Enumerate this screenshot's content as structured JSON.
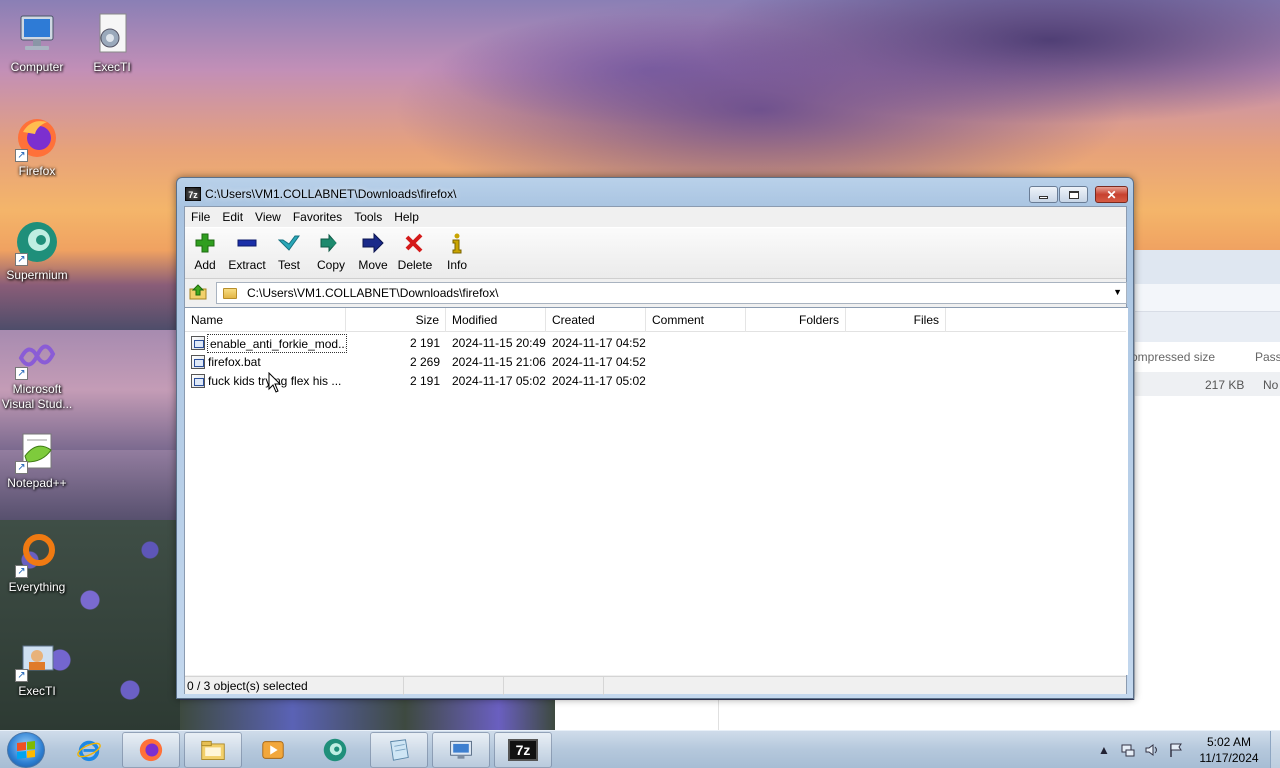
{
  "desktop": {
    "icons": [
      {
        "label": "Computer"
      },
      {
        "label": "ExecTI"
      },
      {
        "label": "Firefox"
      },
      {
        "label": "Supermium"
      },
      {
        "label": "Microsoft Visual Stud..."
      },
      {
        "label": "Notepad++"
      },
      {
        "label": "Everything"
      },
      {
        "label": "ExecTI"
      }
    ]
  },
  "background_window": {
    "column_compressed": "ompressed size",
    "column_password": "Passw",
    "row_size": "217 KB",
    "row_password": "No"
  },
  "window": {
    "title": "C:\\Users\\VM1.COLLABNET\\Downloads\\firefox\\",
    "app_icon_text": "7z",
    "menu": [
      "File",
      "Edit",
      "View",
      "Favorites",
      "Tools",
      "Help"
    ],
    "toolbar": [
      {
        "label": "Add",
        "icon": "plus-icon",
        "color": "#2f9e1f"
      },
      {
        "label": "Extract",
        "icon": "minus-icon",
        "color": "#1a2fa8"
      },
      {
        "label": "Test",
        "icon": "check-icon",
        "color": "#2aa8b8"
      },
      {
        "label": "Copy",
        "icon": "double-arrow-icon",
        "color": "#1d8a6e"
      },
      {
        "label": "Move",
        "icon": "arrow-right-icon",
        "color": "#1a2a8a"
      },
      {
        "label": "Delete",
        "icon": "x-icon",
        "color": "#d41a1a"
      },
      {
        "label": "Info",
        "icon": "info-icon",
        "color": "#c9a400"
      }
    ],
    "address": "C:\\Users\\VM1.COLLABNET\\Downloads\\firefox\\",
    "columns": [
      "Name",
      "Size",
      "Modified",
      "Created",
      "Comment",
      "Folders",
      "Files"
    ],
    "files": [
      {
        "name": "enable_anti_forkie_mod...",
        "size": "2 191",
        "modified": "2024-11-15 20:49",
        "created": "2024-11-17 04:52"
      },
      {
        "name": "firefox.bat",
        "size": "2 269",
        "modified": "2024-11-15 21:06",
        "created": "2024-11-17 04:52"
      },
      {
        "name": "fuck kids trying flex his ...",
        "size": "2 191",
        "modified": "2024-11-17 05:02",
        "created": "2024-11-17 05:02"
      }
    ],
    "status": "0 / 3 object(s) selected"
  },
  "taskbar": {
    "pinned": [
      "internet-explorer-icon",
      "firefox-icon",
      "explorer-folder-icon",
      "media-player-icon",
      "supermium-icon",
      "notepad-icon",
      "remote-desktop-icon",
      "7zip-icon"
    ],
    "sevenzip_label": "7z",
    "clock_time": "5:02 AM",
    "clock_date": "11/17/2024"
  }
}
